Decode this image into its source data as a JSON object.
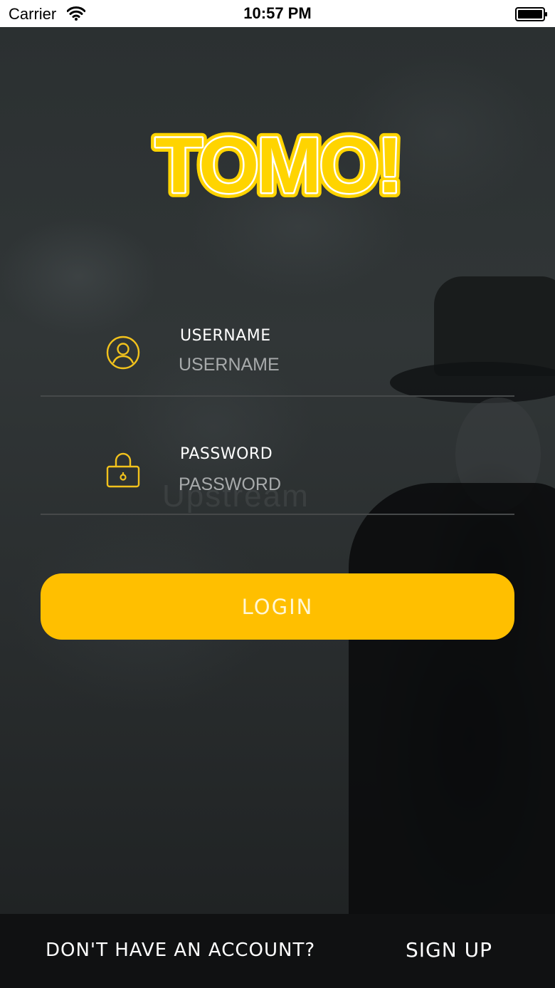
{
  "status_bar": {
    "carrier": "Carrier",
    "time": "10:57 PM"
  },
  "logo": {
    "text": "TOMO!",
    "color": "#ffd400"
  },
  "login_form": {
    "username": {
      "label": "USERNAME",
      "placeholder": "USERNAME",
      "value": "",
      "icon": "user-circle-icon"
    },
    "password": {
      "label": "PASSWORD",
      "placeholder": "PASSWORD",
      "value": "",
      "icon": "padlock-icon"
    },
    "login_label": "LOGIN"
  },
  "watermark": "Upstream",
  "footer": {
    "question": "DON'T HAVE AN ACCOUNT?",
    "signup_label": "SIGN UP"
  },
  "colors": {
    "accent": "#ffbf00",
    "icon": "#f2c21c",
    "footer_bg": "#101112"
  }
}
